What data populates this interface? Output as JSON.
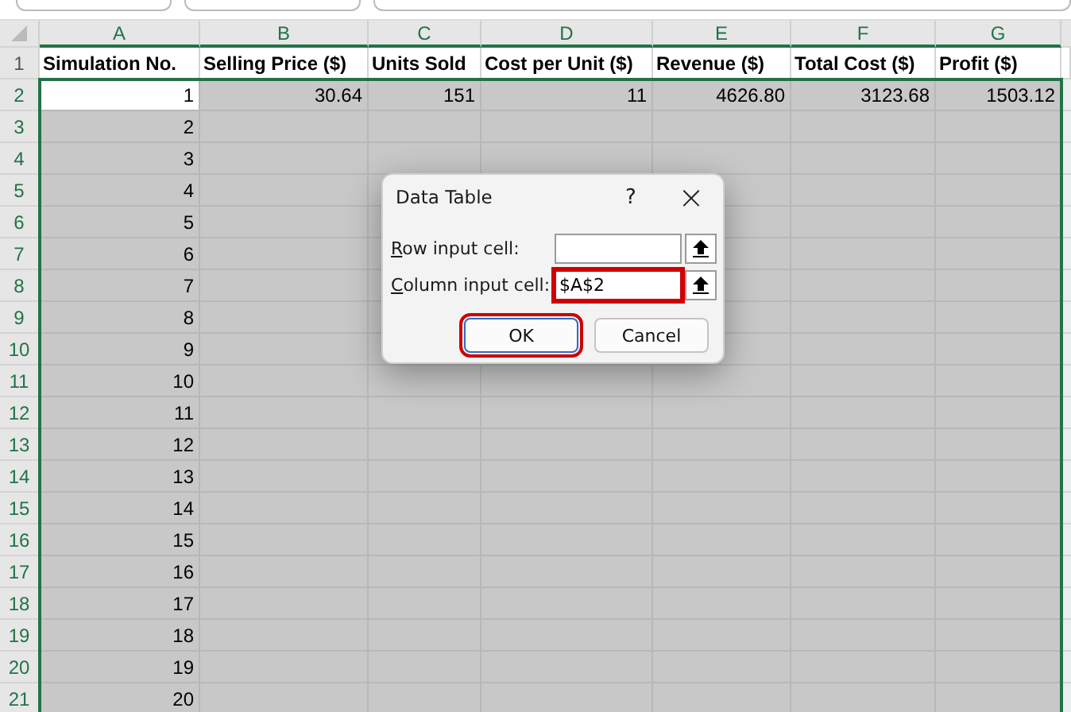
{
  "sheet": {
    "columns": [
      "A",
      "B",
      "C",
      "D",
      "E",
      "F",
      "G"
    ],
    "header_row": {
      "number": "1",
      "cells": [
        "Simulation No.",
        "Selling Price ($)",
        "Units Sold",
        "Cost per Unit ($)",
        "Revenue ($)",
        "Total Cost ($)",
        "Profit ($)"
      ]
    },
    "rows": [
      {
        "number": "2",
        "selected": true,
        "cells": [
          "1",
          "30.64",
          "151",
          "11",
          "4626.80",
          "3123.68",
          "1503.12"
        ]
      },
      {
        "number": "3",
        "selected": true,
        "cells": [
          "2"
        ]
      },
      {
        "number": "4",
        "selected": true,
        "cells": [
          "3"
        ]
      },
      {
        "number": "5",
        "selected": true,
        "cells": [
          "4"
        ]
      },
      {
        "number": "6",
        "selected": true,
        "cells": [
          "5"
        ]
      },
      {
        "number": "7",
        "selected": true,
        "cells": [
          "6"
        ]
      },
      {
        "number": "8",
        "selected": true,
        "cells": [
          "7"
        ]
      },
      {
        "number": "9",
        "selected": true,
        "cells": [
          "8"
        ]
      },
      {
        "number": "10",
        "selected": true,
        "cells": [
          "9"
        ]
      },
      {
        "number": "11",
        "selected": true,
        "cells": [
          "10"
        ]
      },
      {
        "number": "12",
        "selected": true,
        "cells": [
          "11"
        ]
      },
      {
        "number": "13",
        "selected": true,
        "cells": [
          "12"
        ]
      },
      {
        "number": "14",
        "selected": true,
        "cells": [
          "13"
        ]
      },
      {
        "number": "15",
        "selected": true,
        "cells": [
          "14"
        ]
      },
      {
        "number": "16",
        "selected": true,
        "cells": [
          "15"
        ]
      },
      {
        "number": "17",
        "selected": true,
        "cells": [
          "16"
        ]
      },
      {
        "number": "18",
        "selected": true,
        "cells": [
          "17"
        ]
      },
      {
        "number": "19",
        "selected": true,
        "cells": [
          "18"
        ]
      },
      {
        "number": "20",
        "selected": true,
        "cells": [
          "19"
        ]
      },
      {
        "number": "21",
        "selected": true,
        "cells": [
          "20"
        ]
      }
    ]
  },
  "dialog": {
    "title": "Data Table",
    "help": "?",
    "close": "×",
    "fields": [
      {
        "label": "Row input cell:",
        "highlighted": false
      },
      {
        "label": "Column input cell:",
        "value": "$A$2",
        "highlighted": true
      }
    ],
    "buttons": [
      {
        "label": "OK",
        "highlighted": true
      },
      {
        "label": "Cancel",
        "highlighted": false
      }
    ]
  }
}
